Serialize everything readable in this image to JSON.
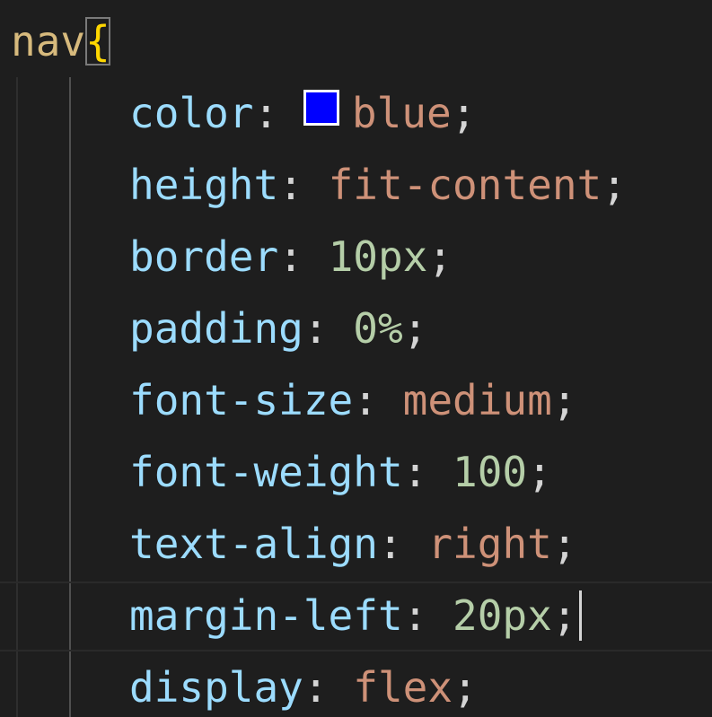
{
  "editor": {
    "selector": "nav",
    "open_brace": "{",
    "declarations": [
      {
        "property": "color",
        "value": "blue",
        "value_type": "string",
        "swatch_color": "#0000ff"
      },
      {
        "property": "height",
        "value": "fit-content",
        "value_type": "string"
      },
      {
        "property": "border",
        "value": "10px",
        "value_type": "number"
      },
      {
        "property": "padding",
        "value": "0%",
        "value_type": "number"
      },
      {
        "property": "font-size",
        "value": "medium",
        "value_type": "string"
      },
      {
        "property": "font-weight",
        "value": "100",
        "value_type": "number"
      },
      {
        "property": "text-align",
        "value": "right",
        "value_type": "string"
      },
      {
        "property": "margin-left",
        "value": "20px",
        "value_type": "number",
        "has_cursor": true
      },
      {
        "property": "display",
        "value": "flex",
        "value_type": "string"
      }
    ],
    "colon": ":",
    "semicolon": ";",
    "colors": {
      "background": "#1e1e1e",
      "selector": "#d7ba7d",
      "brace": "#ffd700",
      "property": "#9cdcfe",
      "string_value": "#ce9178",
      "numeric_value": "#b5cea8",
      "punctuation": "#d4d4d4"
    }
  }
}
